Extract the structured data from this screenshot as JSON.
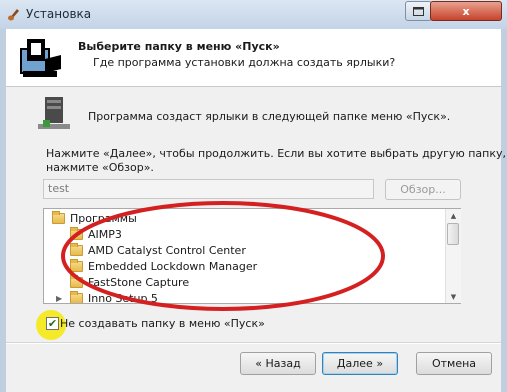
{
  "window": {
    "title": "Установка",
    "close_label": "x"
  },
  "header": {
    "title": "Выберите папку в меню «Пуск»",
    "subtitle": "Где программа установки должна создать ярлыки?"
  },
  "body": {
    "info": "Программа создаст ярлыки в следующей папке меню «Пуск».",
    "hint_line1": "Нажмите «Далее», чтобы продолжить. Если вы хотите выбрать другую папку,",
    "hint_line2": "нажмите «Обзор».",
    "folder_value": "test",
    "browse_label": "Обзор..."
  },
  "tree": {
    "root": "Программы",
    "items": [
      "AIMP3",
      "AMD Catalyst Control Center",
      "Embedded Lockdown Manager",
      "FastStone Capture",
      "Inno Setup 5"
    ]
  },
  "checkbox": {
    "checked": true,
    "label": "Не создавать папку в меню «Пуск»"
  },
  "buttons": {
    "back": "« Назад",
    "next": "Далее »",
    "cancel": "Отмена"
  },
  "colors": {
    "annotation_ellipse": "#d42020",
    "highlight": "#f5ea2a"
  }
}
